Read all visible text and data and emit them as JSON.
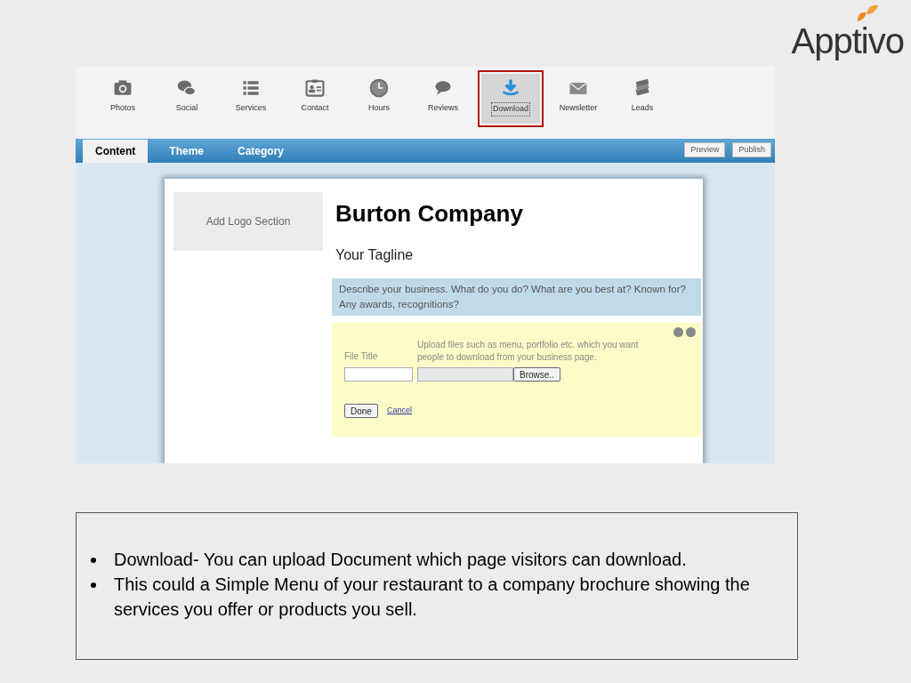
{
  "logo": {
    "text": "Apptivo"
  },
  "toolbar": [
    {
      "label": "Photos",
      "kind": "camera",
      "selected": false
    },
    {
      "label": "Social",
      "kind": "chat",
      "selected": false
    },
    {
      "label": "Services",
      "kind": "list",
      "selected": false
    },
    {
      "label": "Contact",
      "kind": "card",
      "selected": false
    },
    {
      "label": "Hours",
      "kind": "clock",
      "selected": false
    },
    {
      "label": "Reviews",
      "kind": "bubble",
      "selected": false
    },
    {
      "label": "Download",
      "kind": "download",
      "selected": true
    },
    {
      "label": "Newsletter",
      "kind": "envelope",
      "selected": false
    },
    {
      "label": "Leads",
      "kind": "stack",
      "selected": false
    }
  ],
  "tabs": [
    {
      "label": "Content",
      "selected": true
    },
    {
      "label": "Theme",
      "selected": false
    },
    {
      "label": "Category",
      "selected": false
    }
  ],
  "actions": [
    "Preview",
    "Publish"
  ],
  "page": {
    "logo_section": "Add Logo Section",
    "company": "Burton Company",
    "tagline": "Your Tagline",
    "description": "Describe your business. What do you do? What are you best at? Known for? Any awards, recognitions?",
    "upload": {
      "file_title_label": "File Title",
      "hint": "Upload files such as menu, portfolio etc. which you want people to download from your business page.",
      "browse": "Browse..",
      "done": "Done",
      "cancel": "Cancel"
    }
  },
  "notes": [
    "Download- You can upload Document which page visitors can download.",
    "This could a Simple Menu of your restaurant to a company brochure showing the services you offer or products you sell."
  ]
}
